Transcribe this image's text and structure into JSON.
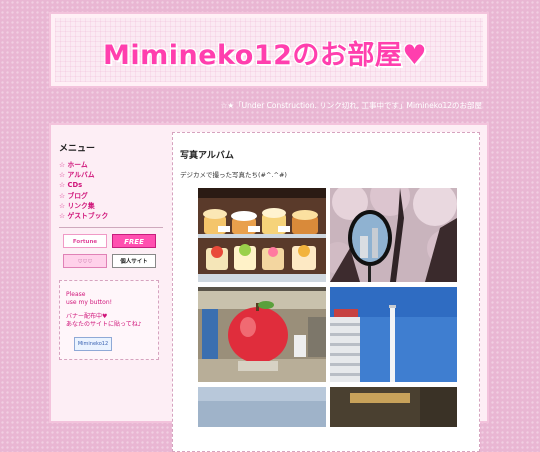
{
  "header": {
    "title": "Mimineko12のお部屋♥"
  },
  "notice": {
    "text": "☆★「Under Construction. リンク切れ, 工事中です」Mimineko12のお部屋"
  },
  "sidebar": {
    "menu_heading": "メニュー",
    "items": [
      {
        "label": "☆ ホーム"
      },
      {
        "label": "☆ アルバム"
      },
      {
        "label": "☆ CDs"
      },
      {
        "label": "☆ ブログ"
      },
      {
        "label": "☆ リンク集"
      },
      {
        "label": "☆ ゲストブック"
      }
    ],
    "banners": [
      {
        "label": "Fortune"
      },
      {
        "label": "FREE"
      },
      {
        "label": "♡♡♡"
      },
      {
        "label": "個人サイト"
      }
    ],
    "mybutton": {
      "line1": "Please",
      "line2": "use my button!",
      "line3": "バナー配布中♥",
      "line4": "あなたのサイトに貼ってね♪",
      "banner_label": "Mimineko12"
    }
  },
  "main": {
    "title": "写真アルバム",
    "description": "デジカメで撮った写真たち(#^.^#)",
    "photos": [
      {
        "icon": "food-display-photo"
      },
      {
        "icon": "cherry-blossom-mirror-photo"
      },
      {
        "icon": "apple-statue-photo"
      },
      {
        "icon": "building-chimney-photo"
      },
      {
        "icon": "sky-photo"
      },
      {
        "icon": "street-photo"
      }
    ]
  },
  "colors": {
    "background": "#e9b6d3",
    "title_pink": "#ff3fae",
    "menu_link": "#d0157a",
    "panel": "#fdeef5"
  }
}
